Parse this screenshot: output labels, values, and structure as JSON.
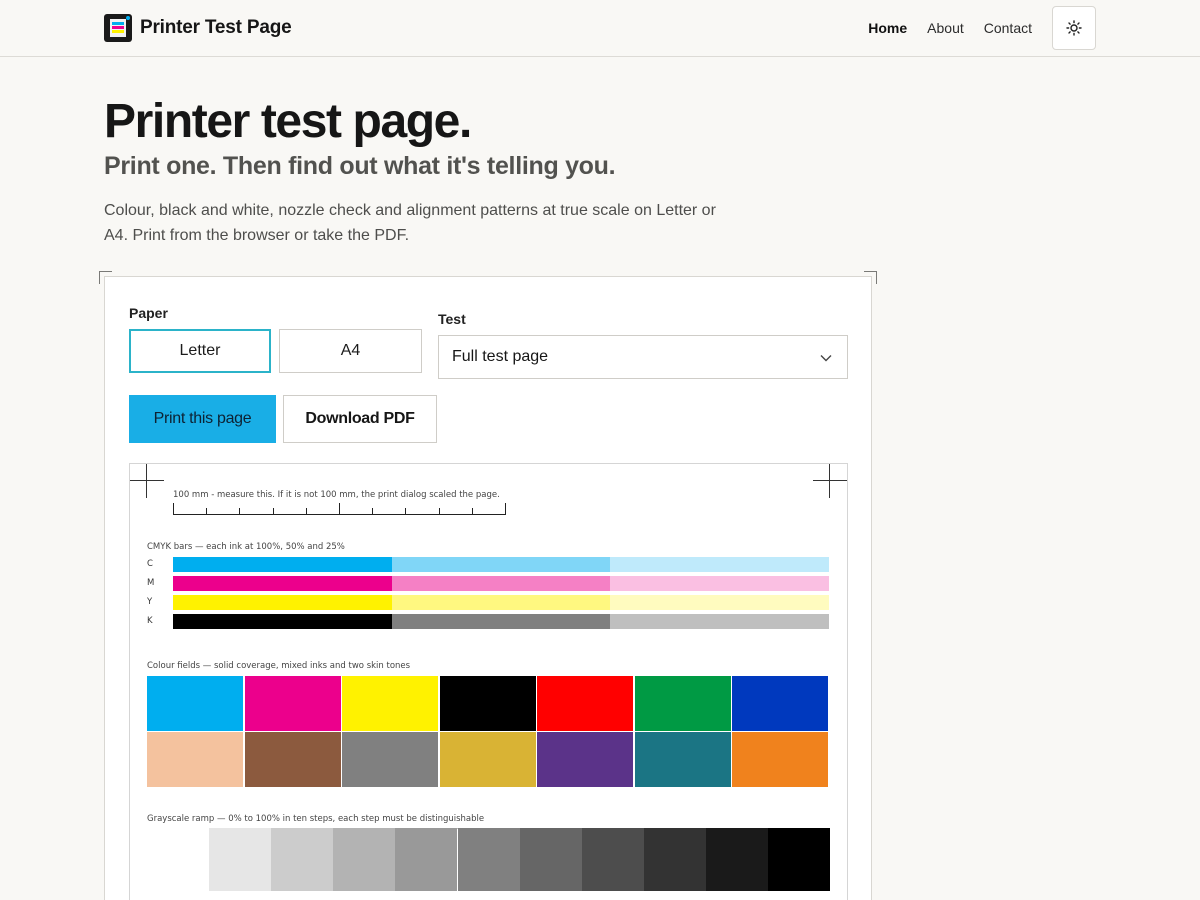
{
  "header": {
    "brand": "Printer Test Page",
    "nav": [
      "Home",
      "About",
      "Contact"
    ],
    "active_nav": "Home"
  },
  "hero": {
    "title": "Printer test page.",
    "subtitle": "Print one. Then find out what it's telling you.",
    "description": "Colour, black and white, nozzle check and alignment patterns at true scale on Letter or A4. Print from the browser or take the PDF."
  },
  "controls": {
    "paper_label": "Paper",
    "paper_options": [
      "Letter",
      "A4"
    ],
    "paper_selected": "Letter",
    "test_label": "Test",
    "test_value": "Full test page",
    "print_button": "Print this page",
    "pdf_button": "Download PDF"
  },
  "sheet": {
    "ruler_caption": "100 mm - measure this. If it is not 100 mm, the print dialog scaled the page.",
    "cmyk_caption": "CMYK bars — each ink at 100%, 50% and 25%",
    "cmyk_rows": [
      {
        "label": "C",
        "colors": [
          "#00aeef",
          "#80d6f7",
          "#bfeafb"
        ]
      },
      {
        "label": "M",
        "colors": [
          "#ec008c",
          "#f580c5",
          "#fabfe2"
        ]
      },
      {
        "label": "Y",
        "colors": [
          "#fff200",
          "#fff880",
          "#fffbbf"
        ]
      },
      {
        "label": "K",
        "colors": [
          "#000000",
          "#808080",
          "#bfbfbf"
        ]
      }
    ],
    "fields_caption": "Colour fields — solid coverage, mixed inks and two skin tones",
    "fields": [
      "#00aeef",
      "#ec008c",
      "#fff200",
      "#000000",
      "#ff0000",
      "#009a44",
      "#0039be",
      "#f4c29e",
      "#8c5a3e",
      "#808080",
      "#d9b334",
      "#5b3389",
      "#1b7584",
      "#f0821d"
    ],
    "gray_caption": "Grayscale ramp — 0% to 100% in ten steps, each step must be distinguishable",
    "gray_steps": [
      "#ffffff",
      "#e6e6e6",
      "#cccccc",
      "#b3b3b3",
      "#999999",
      "#808080",
      "#666666",
      "#4d4d4d",
      "#333333",
      "#1a1a1a",
      "#000000"
    ]
  },
  "icons": {
    "theme_toggle": "sun-icon",
    "select_chevron": "chevron-down-icon"
  }
}
